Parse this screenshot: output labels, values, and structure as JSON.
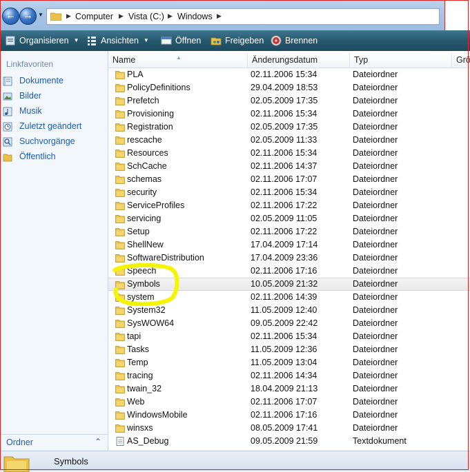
{
  "address": {
    "crumbs": [
      "Computer",
      "Vista (C:)",
      "Windows"
    ]
  },
  "toolbar": {
    "items": [
      {
        "label": "Organisieren",
        "icon": "organize-icon",
        "dropdown": true
      },
      {
        "label": "Ansichten",
        "icon": "views-icon",
        "dropdown": true
      },
      {
        "label": "Öffnen",
        "icon": "open-icon",
        "dropdown": false
      },
      {
        "label": "Freigeben",
        "icon": "share-icon",
        "dropdown": false
      },
      {
        "label": "Brennen",
        "icon": "burn-icon",
        "dropdown": false
      }
    ]
  },
  "navpane": {
    "heading": "Linkfavoriten",
    "items": [
      {
        "label": "Dokumente",
        "icon": "documents-icon"
      },
      {
        "label": "Bilder",
        "icon": "pictures-icon"
      },
      {
        "label": "Musik",
        "icon": "music-icon"
      },
      {
        "label": "Zuletzt geändert",
        "icon": "recent-icon"
      },
      {
        "label": "Suchvorgänge",
        "icon": "searches-icon"
      },
      {
        "label": "Öffentlich",
        "icon": "public-folder-icon"
      }
    ],
    "folders_label": "Ordner"
  },
  "columns": {
    "name": "Name",
    "date": "Änderungsdatum",
    "type": "Typ",
    "size": "Grö"
  },
  "files": [
    {
      "name": "PLA",
      "date": "02.11.2006 15:34",
      "type": "Dateiordner",
      "kind": "folder"
    },
    {
      "name": "PolicyDefinitions",
      "date": "29.04.2009 18:53",
      "type": "Dateiordner",
      "kind": "folder"
    },
    {
      "name": "Prefetch",
      "date": "02.05.2009 17:35",
      "type": "Dateiordner",
      "kind": "folder"
    },
    {
      "name": "Provisioning",
      "date": "02.11.2006 15:34",
      "type": "Dateiordner",
      "kind": "folder"
    },
    {
      "name": "Registration",
      "date": "02.05.2009 17:35",
      "type": "Dateiordner",
      "kind": "folder"
    },
    {
      "name": "rescache",
      "date": "02.05.2009 11:33",
      "type": "Dateiordner",
      "kind": "folder"
    },
    {
      "name": "Resources",
      "date": "02.11.2006 15:34",
      "type": "Dateiordner",
      "kind": "folder"
    },
    {
      "name": "SchCache",
      "date": "02.11.2006 14:37",
      "type": "Dateiordner",
      "kind": "folder"
    },
    {
      "name": "schemas",
      "date": "02.11.2006 17:07",
      "type": "Dateiordner",
      "kind": "folder"
    },
    {
      "name": "security",
      "date": "02.11.2006 15:34",
      "type": "Dateiordner",
      "kind": "folder"
    },
    {
      "name": "ServiceProfiles",
      "date": "02.11.2006 17:22",
      "type": "Dateiordner",
      "kind": "folder"
    },
    {
      "name": "servicing",
      "date": "02.05.2009 11:05",
      "type": "Dateiordner",
      "kind": "folder"
    },
    {
      "name": "Setup",
      "date": "02.11.2006 17:22",
      "type": "Dateiordner",
      "kind": "folder"
    },
    {
      "name": "ShellNew",
      "date": "17.04.2009 17:14",
      "type": "Dateiordner",
      "kind": "folder"
    },
    {
      "name": "SoftwareDistribution",
      "date": "17.04.2009 23:36",
      "type": "Dateiordner",
      "kind": "folder"
    },
    {
      "name": "Speech",
      "date": "02.11.2006 17:16",
      "type": "Dateiordner",
      "kind": "folder"
    },
    {
      "name": "Symbols",
      "date": "10.05.2009 21:32",
      "type": "Dateiordner",
      "kind": "folder",
      "selected": true
    },
    {
      "name": "system",
      "date": "02.11.2006 14:39",
      "type": "Dateiordner",
      "kind": "folder"
    },
    {
      "name": "System32",
      "date": "11.05.2009 12:40",
      "type": "Dateiordner",
      "kind": "folder"
    },
    {
      "name": "SysWOW64",
      "date": "09.05.2009 22:42",
      "type": "Dateiordner",
      "kind": "folder"
    },
    {
      "name": "tapi",
      "date": "02.11.2006 15:34",
      "type": "Dateiordner",
      "kind": "folder"
    },
    {
      "name": "Tasks",
      "date": "11.05.2009 12:36",
      "type": "Dateiordner",
      "kind": "folder"
    },
    {
      "name": "Temp",
      "date": "11.05.2009 13:04",
      "type": "Dateiordner",
      "kind": "folder"
    },
    {
      "name": "tracing",
      "date": "02.11.2006 14:34",
      "type": "Dateiordner",
      "kind": "folder"
    },
    {
      "name": "twain_32",
      "date": "18.04.2009 21:13",
      "type": "Dateiordner",
      "kind": "folder"
    },
    {
      "name": "Web",
      "date": "02.11.2006 17:07",
      "type": "Dateiordner",
      "kind": "folder"
    },
    {
      "name": "WindowsMobile",
      "date": "02.11.2006 17:16",
      "type": "Dateiordner",
      "kind": "folder"
    },
    {
      "name": "winsxs",
      "date": "08.05.2009 17:41",
      "type": "Dateiordner",
      "kind": "folder"
    },
    {
      "name": "AS_Debug",
      "date": "09.05.2009 21:59",
      "type": "Textdokument",
      "kind": "text"
    }
  ],
  "statusbar": {
    "selected_name": "Symbols"
  },
  "colors": {
    "toolbar": "#26586e",
    "nav_link": "#1e5ab6",
    "highlight_marker": "#f5f500",
    "folder": "#e8c04a"
  }
}
